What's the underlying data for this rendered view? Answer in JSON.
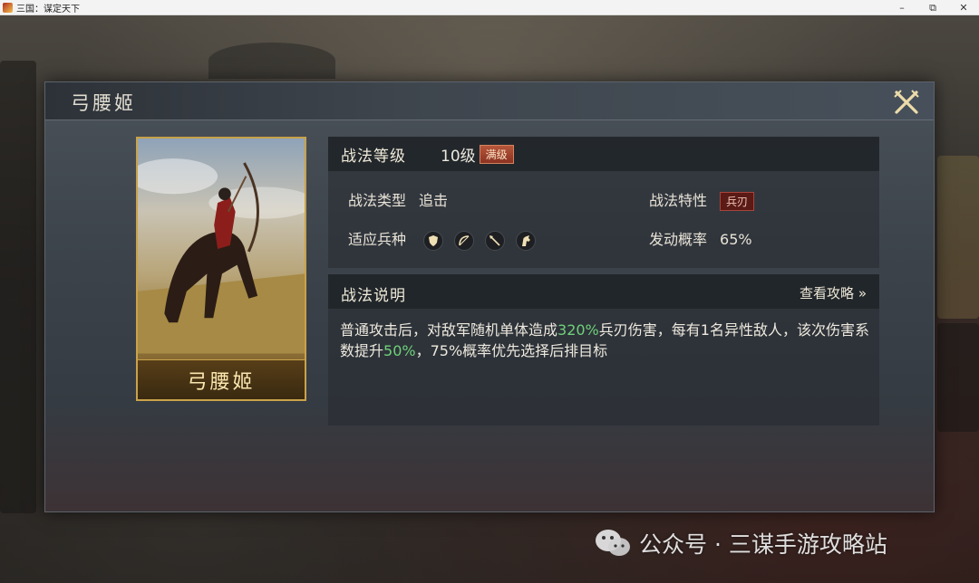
{
  "window": {
    "title": "三国：谋定天下",
    "minimize_glyph": "–",
    "restore_glyph": "⧉",
    "close_glyph": "✕"
  },
  "dialog": {
    "title": "弓腰姬",
    "close_icon": "crossed-swords-icon"
  },
  "hero_card": {
    "name": "弓腰姬"
  },
  "tactic": {
    "level_label": "战法等级",
    "level_value": "10级",
    "maxed_badge": "满级",
    "type_label": "战法类型",
    "type_value": "追击",
    "trait_label": "战法特性",
    "trait_value": "兵刃",
    "troops_label": "适应兵种",
    "troop_icons": [
      "shield-icon",
      "bow-icon",
      "spear-icon",
      "horse-icon"
    ],
    "rate_label": "发动概率",
    "rate_value": "65%"
  },
  "description": {
    "title": "战法说明",
    "guide_link": "查看攻略 »",
    "part1": "普通攻击后，对敌军随机单体造成",
    "hl1": "320%",
    "part2": "兵刃伤害，每有1名异性敌人，该次伤害系数提升",
    "hl2": "50%",
    "part3": "，75%概率优先选择后排目标",
    "highlight_color": "#6fd17a"
  },
  "watermark": {
    "text": "公众号 · 三谋手游攻略站"
  }
}
